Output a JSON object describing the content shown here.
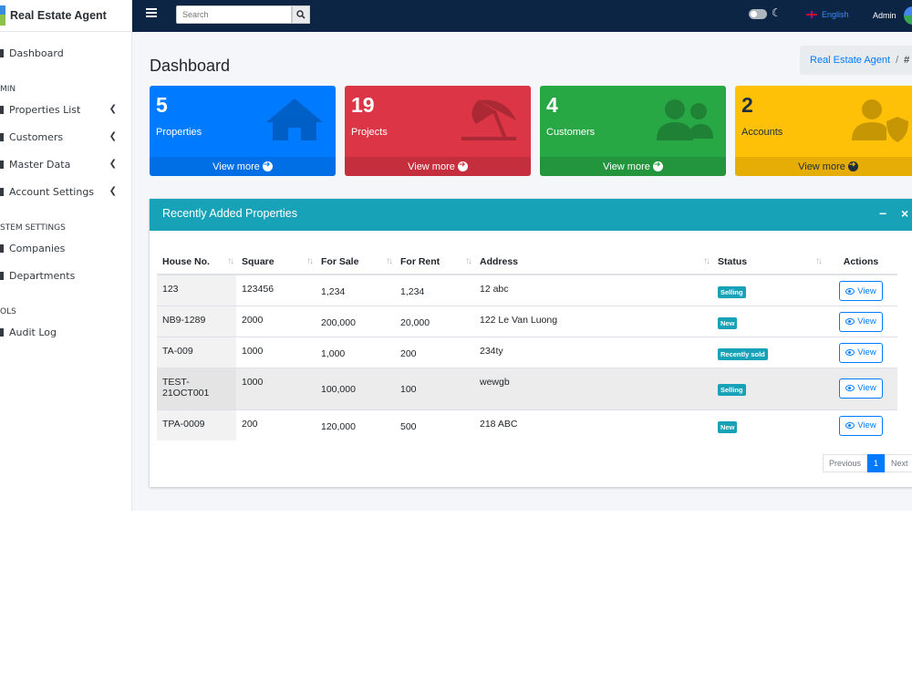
{
  "sidebar": {
    "brand": "Real Estate Agent",
    "items": [
      {
        "label": "Dashboard"
      },
      {
        "header": "MIN"
      },
      {
        "label": "Properties List"
      },
      {
        "label": "Customers"
      },
      {
        "label": "Master Data"
      },
      {
        "label": "Account Settings"
      },
      {
        "header": "STEM SETTINGS"
      },
      {
        "label": "Companies"
      },
      {
        "label": "Departments"
      },
      {
        "header": "OLS"
      },
      {
        "label": "Audit Log"
      }
    ]
  },
  "topbar": {
    "search_placeholder": "Search",
    "language": "English",
    "user": "Admin"
  },
  "page": {
    "title": "Dashboard",
    "breadcrumb": [
      "Real Estate Agent",
      "/",
      "#"
    ]
  },
  "boxes": [
    {
      "count": "5",
      "label": "Properties",
      "footer": "View more",
      "color": "#007bff",
      "icon": "home-icon"
    },
    {
      "count": "19",
      "label": "Projects",
      "footer": "View more",
      "color": "#dc3545",
      "icon": "umbrella-beach-icon"
    },
    {
      "count": "4",
      "label": "Customers",
      "footer": "View more",
      "color": "#28a745",
      "icon": "users-icon"
    },
    {
      "count": "2",
      "label": "Accounts",
      "footer": "View more",
      "color": "#ffc107",
      "icon": "user-shield-icon"
    }
  ],
  "card": {
    "title": "Recently Added Properties",
    "columns": [
      "House No.",
      "Square",
      "For Sale",
      "For Rent",
      "Address",
      "Status",
      "Actions"
    ],
    "rows": [
      {
        "house": "123",
        "square": "123456",
        "sale": "1,234",
        "rent": "1,234",
        "address": "12 abc",
        "status": "Selling",
        "action": "View"
      },
      {
        "house": "NB9-1289",
        "square": "2000",
        "sale": "200,000",
        "rent": "20,000",
        "address": "122 Le Van Luong",
        "status": "New",
        "action": "View"
      },
      {
        "house": "TA-009",
        "square": "1000",
        "sale": "1,000",
        "rent": "200",
        "address": "234ty",
        "status": "Recently sold",
        "action": "View"
      },
      {
        "house": "TEST-21OCT001",
        "square": "1000",
        "sale": "100,000",
        "rent": "100",
        "address": "wewgb",
        "status": "Selling",
        "action": "View"
      },
      {
        "house": "TPA-0009",
        "square": "200",
        "sale": "120,000",
        "rent": "500",
        "address": "218 ABC",
        "status": "New",
        "action": "View"
      }
    ]
  },
  "pagination": {
    "previous": "Previous",
    "current": "1",
    "next": "Next"
  }
}
